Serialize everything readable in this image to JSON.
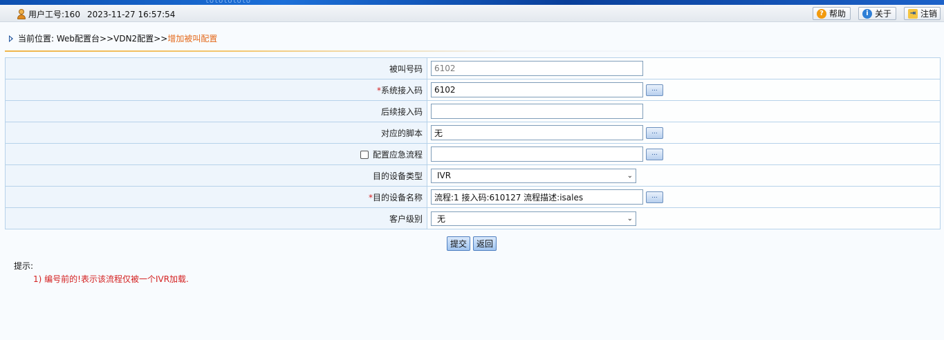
{
  "banner": {
    "decor_text": "lololololo"
  },
  "topbar": {
    "user_label": "用户工号:160",
    "datetime": "2023-11-27 16:57:54",
    "help_label": "帮助",
    "about_label": "关于",
    "logout_label": "注销"
  },
  "breadcrumb": {
    "prefix": "当前位置: Web配置台>>VDN2配置>>",
    "current": "增加被叫配置"
  },
  "form": {
    "called_number": {
      "label": "被叫号码",
      "value": "6102"
    },
    "system_access_code": {
      "required_mark": "*",
      "label": "系统接入码",
      "value": "6102"
    },
    "followup_access_code": {
      "label": "后续接入码",
      "value": ""
    },
    "script": {
      "label": "对应的脚本",
      "value": "无"
    },
    "emergency_flow": {
      "label": "配置应急流程",
      "value": "",
      "checked": false
    },
    "device_type": {
      "label": "目的设备类型",
      "value": "IVR"
    },
    "device_name": {
      "required_mark": "*",
      "label": "目的设备名称",
      "value": "流程:1 接入码:610127 流程描述:isales"
    },
    "customer_level": {
      "label": "客户级别",
      "value": "无"
    },
    "browse_label": "..."
  },
  "actions": {
    "submit_label": "提交",
    "back_label": "返回"
  },
  "hints": {
    "title": "提示:",
    "items": [
      "1) 编号前的!表示该流程仅被一个IVR加载."
    ]
  },
  "colors": {
    "accent": "#e46a1c",
    "required": "#d42020",
    "label_bg": "#eef5fc",
    "border": "#b6d2ea"
  }
}
